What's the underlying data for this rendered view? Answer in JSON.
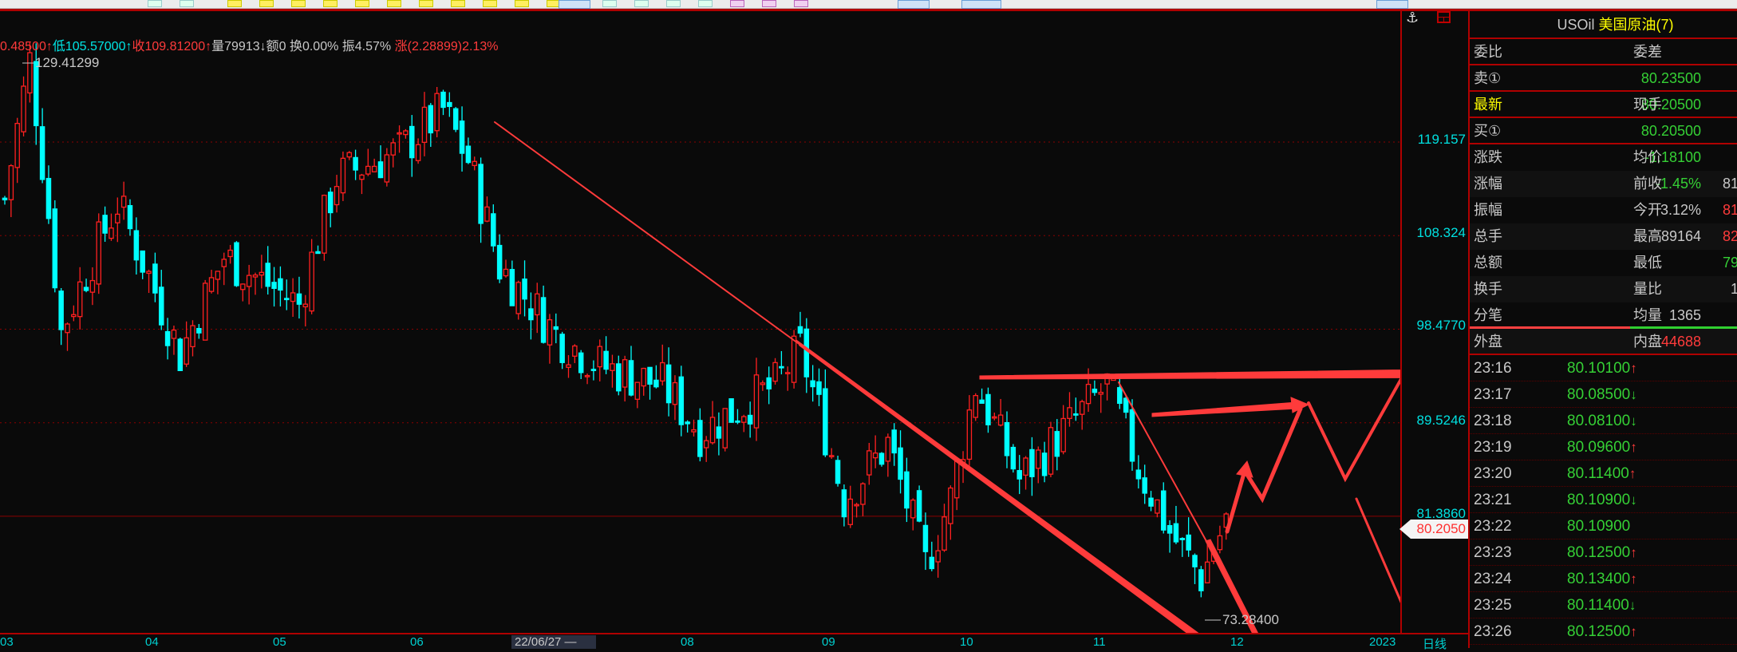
{
  "info_bar": {
    "high": "0.48500↑",
    "low": "低105.57000↑",
    "close": "收109.81200↑",
    "misc": "量79913↓额0 换0.00% 振4.57%",
    "change": "涨(2.28899)2.13%"
  },
  "chart": {
    "high_marker": "129.41299",
    "low_marker": "73.28400",
    "price_axis": [
      "119.157",
      "108.324",
      "98.4770",
      "89.5246",
      "81.3860"
    ],
    "current_price": "80.2050",
    "time_axis": [
      "03",
      "04",
      "05",
      "06",
      "22/06/27 —",
      "08",
      "09",
      "10",
      "11",
      "12",
      "2023",
      "日线"
    ]
  },
  "chart_data": {
    "type": "candlestick",
    "scale": "log",
    "ylim": [
      73.284,
      129.413
    ],
    "close_waypoints": [
      [
        0,
        112.4
      ],
      [
        4,
        129.4
      ],
      [
        9,
        98.2
      ],
      [
        18,
        112
      ],
      [
        28,
        96
      ],
      [
        35,
        106
      ],
      [
        47,
        101
      ],
      [
        53,
        115
      ],
      [
        63,
        118
      ],
      [
        70,
        123.1
      ],
      [
        74,
        117
      ],
      [
        79,
        105
      ],
      [
        88,
        98
      ],
      [
        95,
        94.9
      ],
      [
        105,
        93
      ],
      [
        111,
        88.7
      ],
      [
        123,
        93
      ],
      [
        127,
        96.5
      ],
      [
        134,
        82.8
      ],
      [
        141,
        87.6
      ],
      [
        147,
        77.4
      ],
      [
        151,
        82.8
      ],
      [
        155,
        93
      ],
      [
        162,
        84.5
      ],
      [
        169,
        88.7
      ],
      [
        176,
        93
      ],
      [
        181,
        85.5
      ],
      [
        186,
        80.1
      ],
      [
        191,
        76.5
      ],
      [
        195,
        81
      ]
    ]
  },
  "panel": {
    "symbol": "USOil",
    "name": "美国原油(7)",
    "rows": [
      {
        "l1": "委比",
        "v1": "",
        "l2": "委差",
        "v2": ""
      },
      {
        "l1": "卖①",
        "v1": "80.23500",
        "l2": "",
        "v2": ""
      },
      {
        "l1": "最新",
        "v1": "80.20500",
        "l2": "现手",
        "v2": ""
      },
      {
        "l1": "买①",
        "v1": "80.20500",
        "l2": "",
        "v2": ""
      },
      {
        "l1": "涨跌",
        "v1": "-1.18100",
        "l2": "均价",
        "v2": ""
      },
      {
        "l1": "涨幅",
        "v1": "-1.45%",
        "l2": "前收",
        "v2": "81"
      },
      {
        "l1": "振幅",
        "v1": "3.12%",
        "l2": "今开",
        "v2": "81"
      },
      {
        "l1": "总手",
        "v1": "89164",
        "l2": "最高",
        "v2": "82"
      },
      {
        "l1": "总额",
        "v1": "",
        "l2": "最低",
        "v2": "79"
      },
      {
        "l1": "换手",
        "v1": "",
        "l2": "量比",
        "v2": "1"
      },
      {
        "l1": "分笔",
        "v1": "1365",
        "l2": "均量",
        "v2": ""
      },
      {
        "l1": "外盘",
        "v1": "44688",
        "l2": "内盘",
        "v2": ""
      }
    ],
    "ticks": [
      {
        "time": "23:16",
        "price": "80.10100",
        "dir": "↑"
      },
      {
        "time": "23:17",
        "price": "80.08500",
        "dir": "↓"
      },
      {
        "time": "23:18",
        "price": "80.08100",
        "dir": "↓"
      },
      {
        "time": "23:19",
        "price": "80.09600",
        "dir": "↑"
      },
      {
        "time": "23:20",
        "price": "80.11400",
        "dir": "↑"
      },
      {
        "time": "23:21",
        "price": "80.10900",
        "dir": "↓"
      },
      {
        "time": "23:22",
        "price": "80.10900",
        "dir": ""
      },
      {
        "time": "23:23",
        "price": "80.12500",
        "dir": "↑"
      },
      {
        "time": "23:24",
        "price": "80.13400",
        "dir": "↑"
      },
      {
        "time": "23:25",
        "price": "80.11400",
        "dir": "↓"
      },
      {
        "time": "23:26",
        "price": "80.12500",
        "dir": "↑"
      }
    ]
  },
  "colors": {
    "up": "#ff2020",
    "down": "#00ffff",
    "grid": "#8b0000",
    "annotation": "#ff3b3b"
  }
}
